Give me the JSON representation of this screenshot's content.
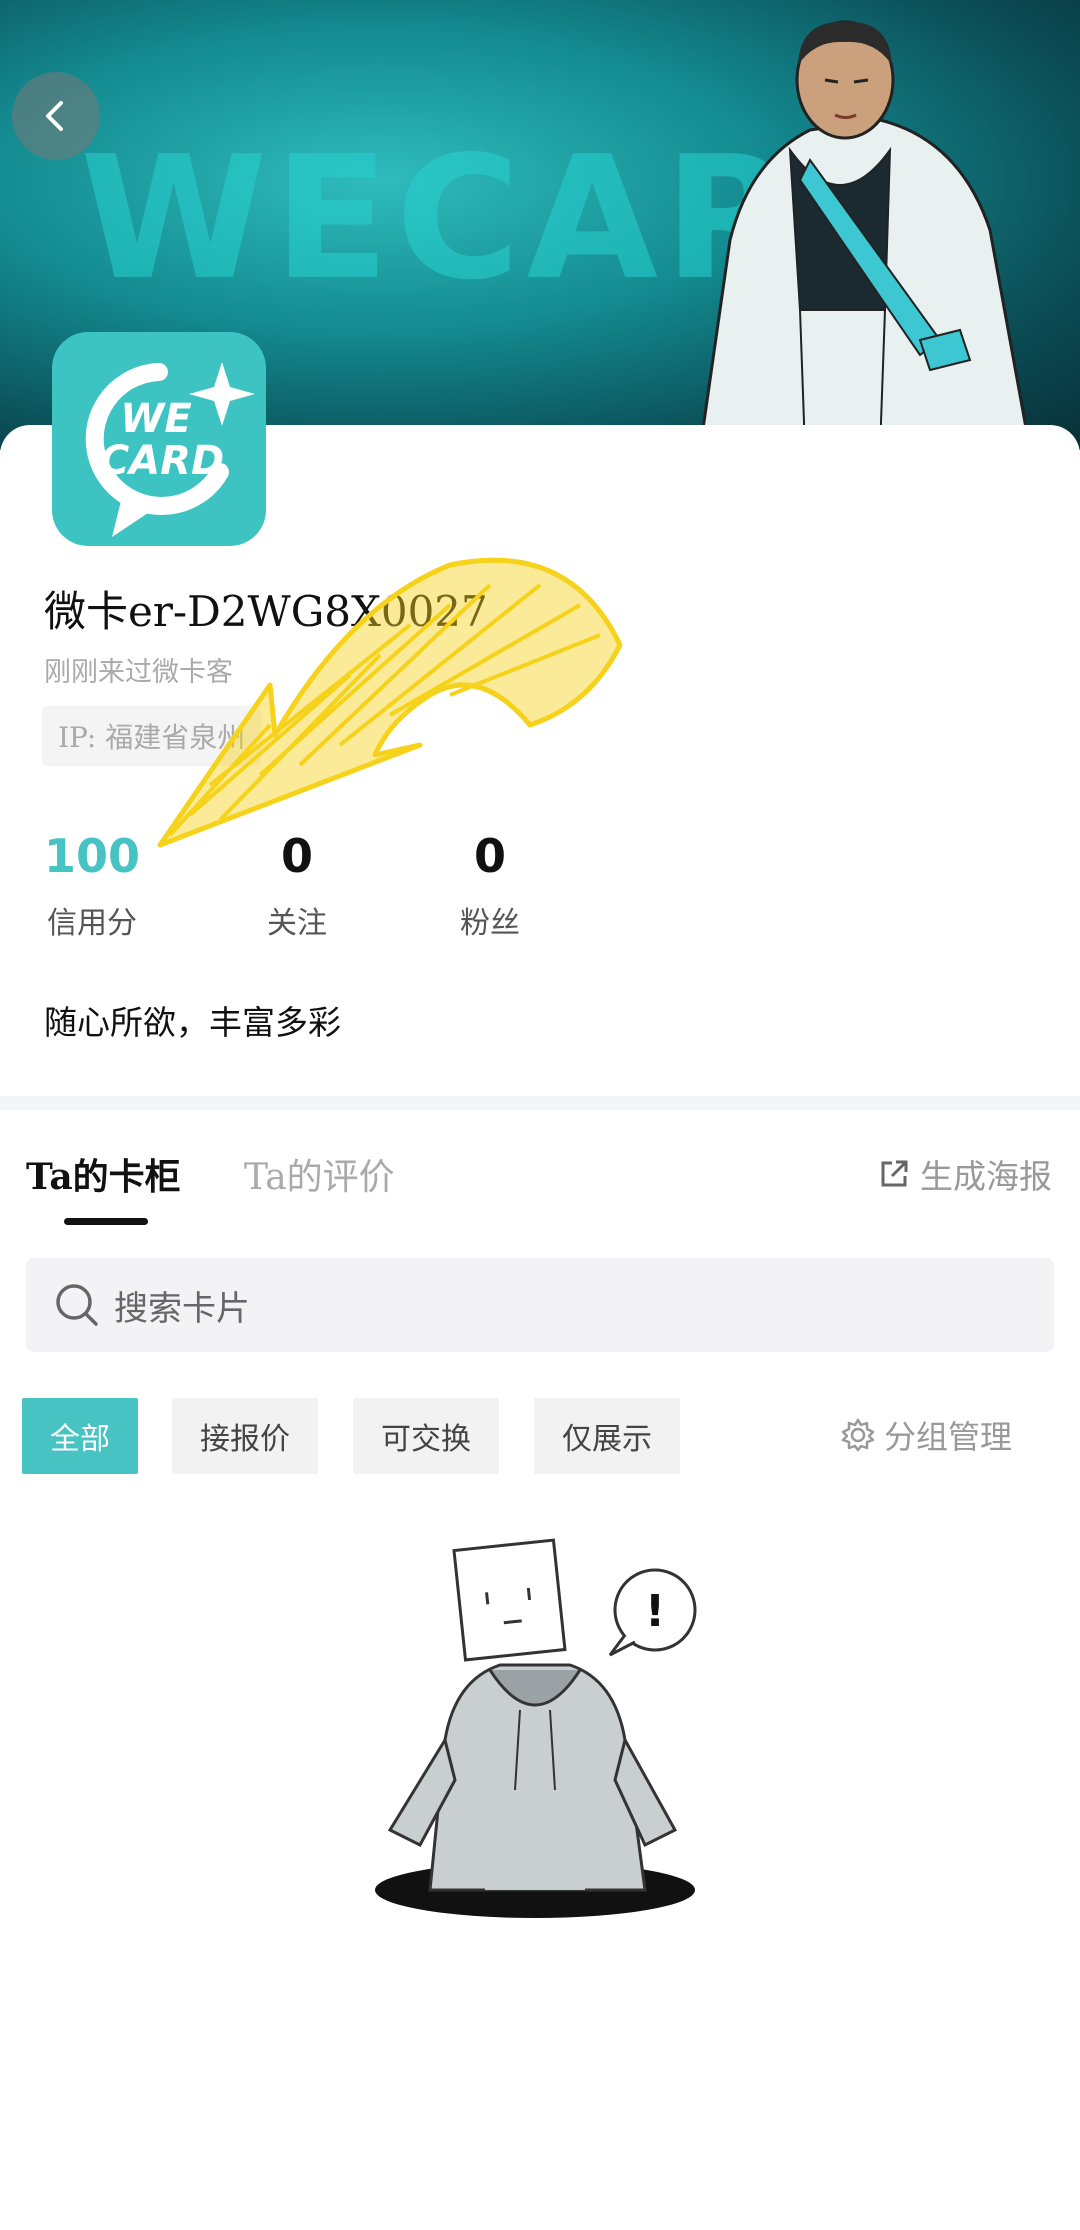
{
  "banner": {
    "bg_text": "WECARD"
  },
  "nav": {
    "back_icon": "chevron-left-icon"
  },
  "profile": {
    "logo_line1": "WE",
    "logo_line2": "CARD",
    "username": "微卡er-D2WG8X0027",
    "last_visit": "刚刚来过微卡客",
    "ip": "IP: 福建省泉州"
  },
  "stats": [
    {
      "value": "100",
      "label": "信用分"
    },
    {
      "value": "0",
      "label": "关注"
    },
    {
      "value": "0",
      "label": "粉丝"
    }
  ],
  "bio": "随心所欲，丰富多彩",
  "tabs": [
    {
      "label": "Ta的卡柜",
      "active": true
    },
    {
      "label": "Ta的评价",
      "active": false
    }
  ],
  "poster": {
    "label": "生成海报",
    "icon": "external-link-icon"
  },
  "search": {
    "placeholder": "搜索卡片",
    "icon": "search-icon"
  },
  "filters": [
    {
      "label": "全部",
      "active": true
    },
    {
      "label": "接报价",
      "active": false
    },
    {
      "label": "可交换",
      "active": false
    },
    {
      "label": "仅展示",
      "active": false
    }
  ],
  "group_manage": {
    "label": "分组管理",
    "icon": "gear-icon"
  },
  "empty_state": {
    "exclaim": "!"
  },
  "colors": {
    "accent": "#47c3c3",
    "banner": "#138a8f",
    "scribble": "#f6d21a"
  }
}
